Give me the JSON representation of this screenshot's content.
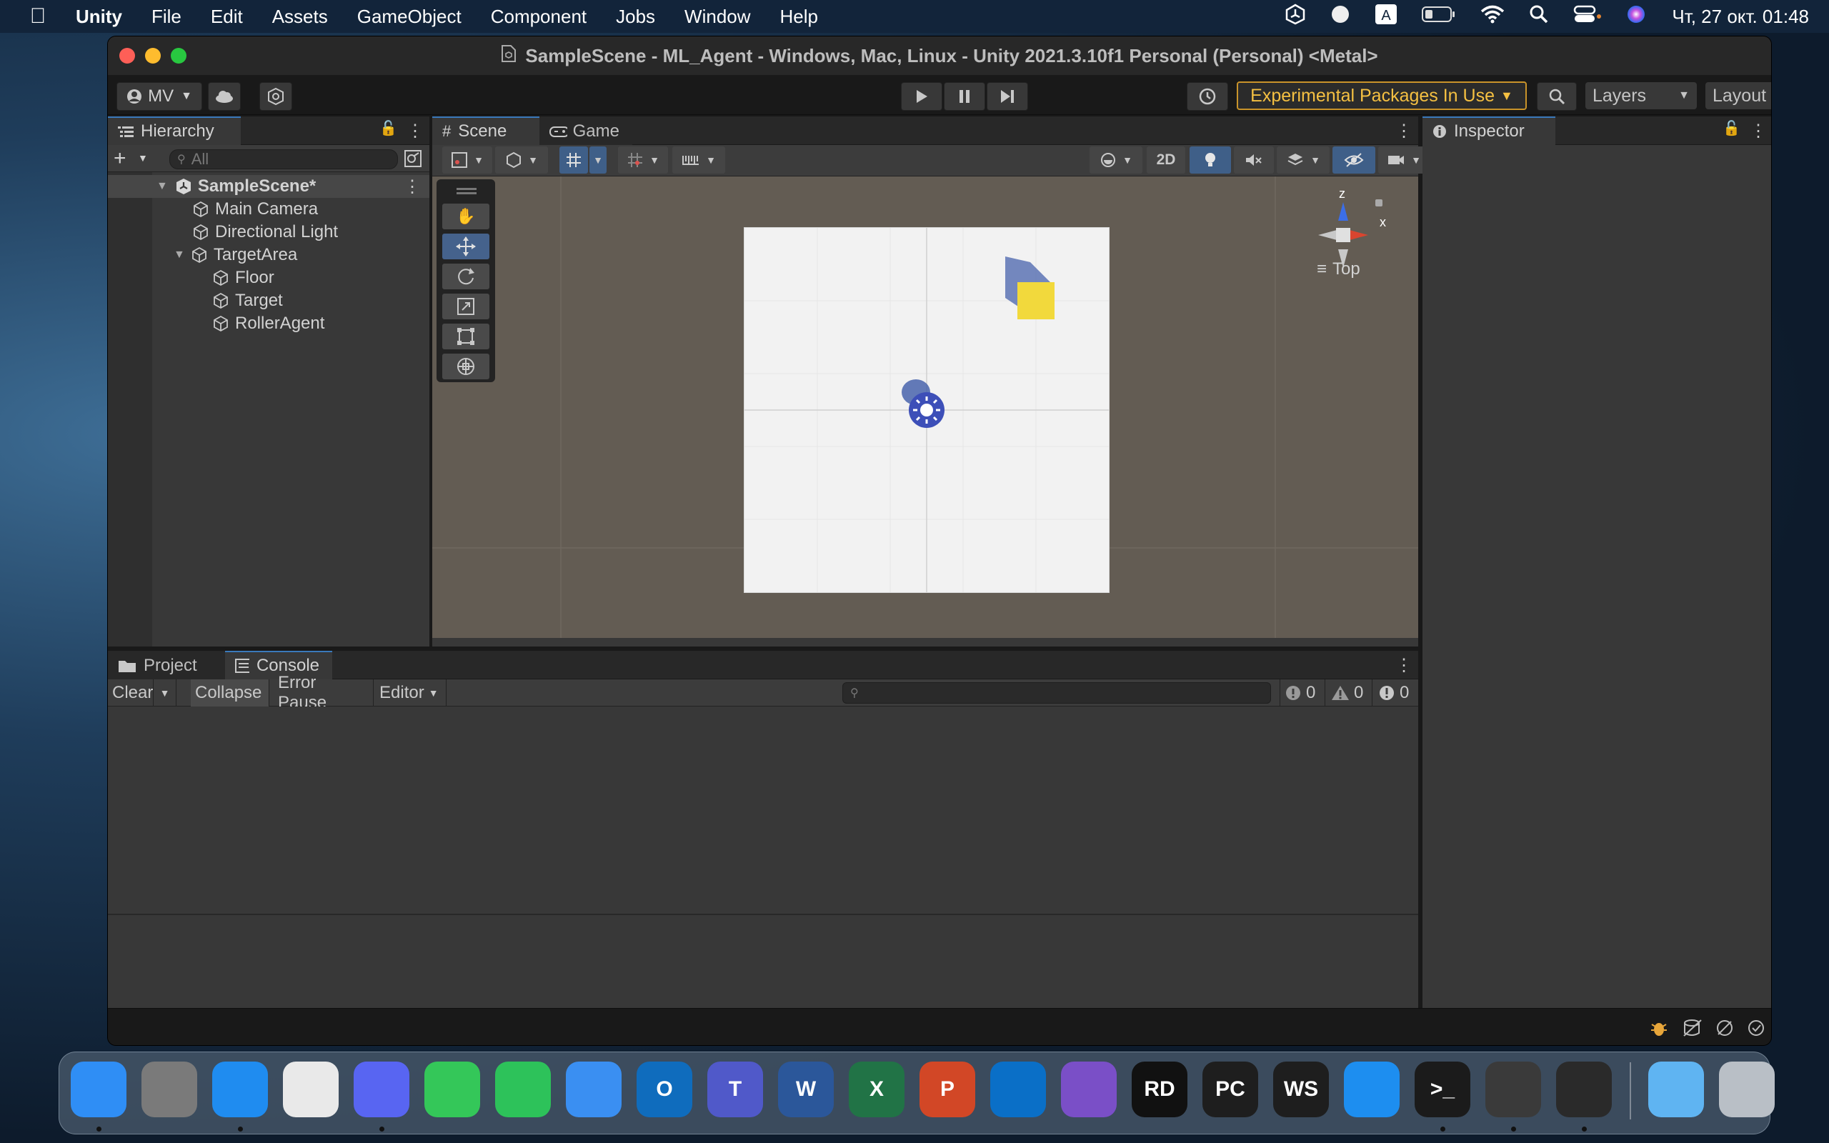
{
  "menubar": {
    "items": [
      "Unity",
      "File",
      "Edit",
      "Assets",
      "GameObject",
      "Component",
      "Jobs",
      "Window",
      "Help"
    ],
    "clock": "Чт, 27 окт.  01:48",
    "status_icons": [
      "unity-icon",
      "circle-icon",
      "input-source-icon",
      "battery-icon",
      "wifi-icon",
      "search-icon",
      "control-center-icon",
      "siri-icon"
    ]
  },
  "window": {
    "title": "SampleScene - ML_Agent - Windows, Mac, Linux - Unity 2021.3.10f1 Personal (Personal) <Metal>"
  },
  "toolbar": {
    "account_label": "MV",
    "experimental_label": "Experimental Packages In Use",
    "layers_label": "Layers",
    "layout_label": "Layout"
  },
  "hierarchy": {
    "tab": "Hierarchy",
    "search_placeholder": "All",
    "scene_name": "SampleScene*",
    "items": [
      {
        "label": "Main Camera"
      },
      {
        "label": "Directional Light"
      },
      {
        "label": "TargetArea"
      },
      {
        "label": "Floor"
      },
      {
        "label": "Target"
      },
      {
        "label": "RollerAgent"
      }
    ]
  },
  "scene": {
    "tabs": [
      "Scene",
      "Game"
    ],
    "mode_2d_label": "2D",
    "gizmo_view_label": "Top",
    "gizmo_axes": {
      "z": "z",
      "x": "x"
    },
    "colors": {
      "background": "#635c53",
      "floor": "#f2f2f2",
      "target": "#f2d93c",
      "agent": "#3d4fb8"
    }
  },
  "inspector": {
    "tab": "Inspector"
  },
  "bottom": {
    "tabs": [
      "Project",
      "Console"
    ],
    "console": {
      "clear": "Clear",
      "collapse": "Collapse",
      "error_pause": "Error Pause",
      "editor": "Editor",
      "log_count": "0",
      "warn_count": "0",
      "error_count": "0"
    }
  },
  "dock": {
    "apps": [
      {
        "name": "Finder",
        "letters": "",
        "color": "#2f8ef5"
      },
      {
        "name": "System Preferences",
        "letters": "",
        "color": "#7a7a7a"
      },
      {
        "name": "Safari",
        "letters": "",
        "color": "#1f8cf0"
      },
      {
        "name": "Chrome",
        "letters": "",
        "color": "#e9e9e9"
      },
      {
        "name": "Discord",
        "letters": "",
        "color": "#5865f2"
      },
      {
        "name": "Messages",
        "letters": "",
        "color": "#34c759"
      },
      {
        "name": "FaceTime",
        "letters": "",
        "color": "#2dc25a"
      },
      {
        "name": "Mail",
        "letters": "",
        "color": "#3a8ff2"
      },
      {
        "name": "Outlook",
        "letters": "O",
        "color": "#0f6cbd"
      },
      {
        "name": "Teams",
        "letters": "T",
        "color": "#5059c9"
      },
      {
        "name": "Word",
        "letters": "W",
        "color": "#2b579a"
      },
      {
        "name": "Excel",
        "letters": "X",
        "color": "#217346"
      },
      {
        "name": "PowerPoint",
        "letters": "P",
        "color": "#d24726"
      },
      {
        "name": "VS Code",
        "letters": "",
        "color": "#0a6fc7"
      },
      {
        "name": "Visual Studio",
        "letters": "",
        "color": "#7a4fc7"
      },
      {
        "name": "Rider",
        "letters": "RD",
        "color": "#111111"
      },
      {
        "name": "PyCharm",
        "letters": "PC",
        "color": "#1e1e1e"
      },
      {
        "name": "WebStorm",
        "letters": "WS",
        "color": "#1e1e1e"
      },
      {
        "name": "App Store",
        "letters": "",
        "color": "#1d8ef0"
      },
      {
        "name": "Terminal",
        "letters": ">_",
        "color": "#1b1b1b"
      },
      {
        "name": "Unity Hub",
        "letters": "",
        "color": "#3a3a3a"
      },
      {
        "name": "Unity",
        "letters": "",
        "color": "#2a2a2a"
      },
      {
        "name": "Folder",
        "letters": "",
        "color": "#5fb4f2"
      },
      {
        "name": "Trash",
        "letters": "",
        "color": "#b9bfc6"
      }
    ]
  }
}
